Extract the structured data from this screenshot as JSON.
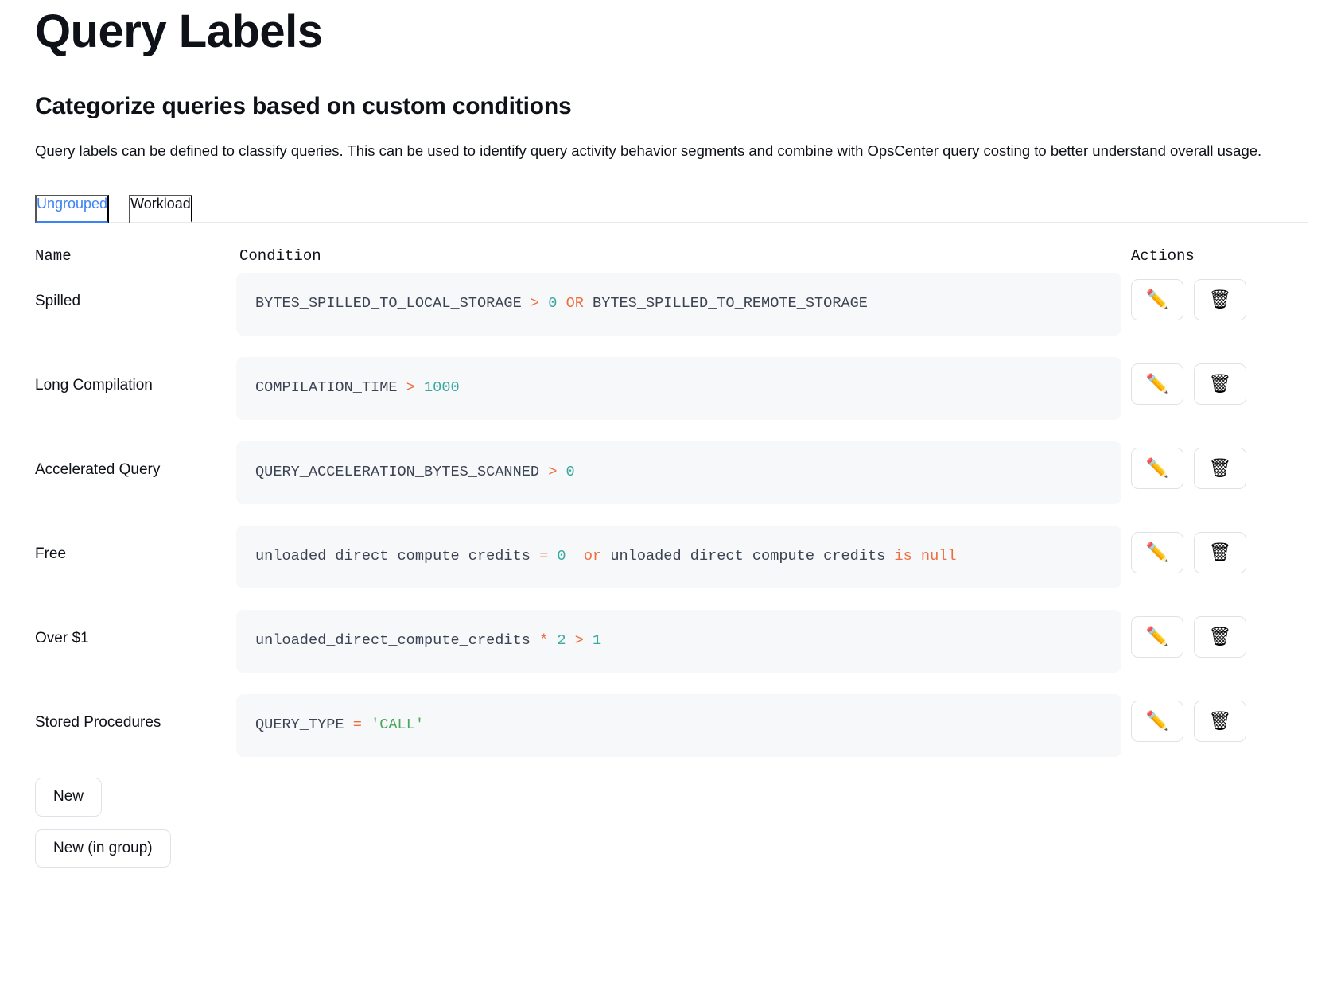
{
  "header": {
    "title": "Query Labels",
    "section_title": "Categorize queries based on custom conditions",
    "description": "Query labels can be defined to classify queries. This can be used to identify query activity behavior segments and combine with OpsCenter query costing to better understand overall usage."
  },
  "tabs": [
    {
      "label": "Ungrouped",
      "active": true
    },
    {
      "label": "Workload",
      "active": false
    }
  ],
  "table": {
    "columns": [
      "Name",
      "Condition",
      "Actions"
    ],
    "rows": [
      {
        "name": "Spilled",
        "condition": "BYTES_SPILLED_TO_LOCAL_STORAGE > 0 OR BYTES_SPILLED_TO_REMOTE_STORAGE",
        "tokens": [
          {
            "t": "BYTES_SPILLED_TO_LOCAL_STORAGE ",
            "k": "id"
          },
          {
            "t": "> ",
            "k": "op"
          },
          {
            "t": "0 ",
            "k": "num"
          },
          {
            "t": "OR ",
            "k": "kw"
          },
          {
            "t": "BYTES_SPILLED_TO_REMOTE_STORAGE",
            "k": "id"
          }
        ]
      },
      {
        "name": "Long Compilation",
        "condition": "COMPILATION_TIME > 1000",
        "tokens": [
          {
            "t": "COMPILATION_TIME ",
            "k": "id"
          },
          {
            "t": "> ",
            "k": "op"
          },
          {
            "t": "1000",
            "k": "num"
          }
        ]
      },
      {
        "name": "Accelerated Query",
        "condition": "QUERY_ACCELERATION_BYTES_SCANNED > 0",
        "tokens": [
          {
            "t": "QUERY_ACCELERATION_BYTES_SCANNED ",
            "k": "id"
          },
          {
            "t": "> ",
            "k": "op"
          },
          {
            "t": "0",
            "k": "num"
          }
        ]
      },
      {
        "name": "Free",
        "condition": "unloaded_direct_compute_credits = 0  or unloaded_direct_compute_credits is null",
        "tokens": [
          {
            "t": "unloaded_direct_compute_credits ",
            "k": "id"
          },
          {
            "t": "= ",
            "k": "op"
          },
          {
            "t": "0  ",
            "k": "num"
          },
          {
            "t": "or ",
            "k": "kw"
          },
          {
            "t": "unloaded_direct_compute_credits ",
            "k": "id"
          },
          {
            "t": "is ",
            "k": "kw"
          },
          {
            "t": "null",
            "k": "kw"
          }
        ]
      },
      {
        "name": "Over $1",
        "condition": "unloaded_direct_compute_credits * 2 > 1",
        "tokens": [
          {
            "t": "unloaded_direct_compute_credits ",
            "k": "id"
          },
          {
            "t": "* ",
            "k": "op"
          },
          {
            "t": "2 ",
            "k": "num"
          },
          {
            "t": "> ",
            "k": "op"
          },
          {
            "t": "1",
            "k": "num"
          }
        ]
      },
      {
        "name": "Stored Procedures",
        "condition": "QUERY_TYPE = 'CALL'",
        "tokens": [
          {
            "t": "QUERY_TYPE ",
            "k": "id"
          },
          {
            "t": "= ",
            "k": "op"
          },
          {
            "t": "'CALL'",
            "k": "str"
          }
        ]
      }
    ],
    "actions": {
      "edit_icon": "pencil-icon",
      "edit_glyph": "✏️",
      "delete_icon": "trash-icon",
      "delete_glyph": "🗑"
    }
  },
  "buttons": {
    "new": "New",
    "new_in_group": "New (in group)"
  },
  "colors": {
    "accent": "#3b82f6",
    "code_bg": "#f7f8f9",
    "operator": "#ef6c3f",
    "number": "#3aa8a0",
    "string": "#4aa65a",
    "identifier": "#3b4252"
  }
}
